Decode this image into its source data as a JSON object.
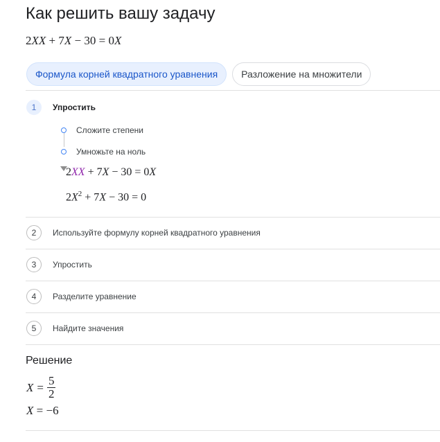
{
  "page": {
    "title": "Как решить вашу задачу"
  },
  "equation": {
    "coef": "2",
    "var1": "X",
    "var2": "X",
    "rest": "+ 7",
    "var3": "X",
    "tail": "− 30 = 0",
    "var4": "X"
  },
  "tabs": [
    {
      "label": "Формула корней квадратного уравнения",
      "active": true
    },
    {
      "label": "Разложение на множители",
      "active": false
    }
  ],
  "steps": [
    {
      "num": "1",
      "label": "Упростить"
    },
    {
      "num": "2",
      "label": "Используйте формулу корней квадратного уравнения"
    },
    {
      "num": "3",
      "label": "Упростить"
    },
    {
      "num": "4",
      "label": "Разделите уравнение"
    },
    {
      "num": "5",
      "label": "Найдите значения"
    }
  ],
  "substeps": [
    {
      "label": "Сложите степени"
    },
    {
      "label": "Умножьте на ноль"
    }
  ],
  "step1_eq_a": {
    "coef": "2",
    "var1": "X",
    "var2": "X",
    "rest": "+ 7",
    "var3": "X",
    "tail": "− 30 = 0",
    "var4": "X"
  },
  "step1_eq_b": {
    "coef": "2",
    "var1": "X",
    "exp": "2",
    "rest": "+ 7",
    "var2": "X",
    "tail": "− 30 = 0"
  },
  "solution": {
    "title": "Решение",
    "x1_var": "X",
    "x1_eq": "=",
    "x1_num": "5",
    "x1_den": "2",
    "x2_var": "X",
    "x2_eq": "= −6"
  },
  "colors": {
    "accent": "#1a56c9",
    "tab_active_bg": "#e8f0fe",
    "highlight": "#8e24aa",
    "divider": "#e0e0e0"
  }
}
